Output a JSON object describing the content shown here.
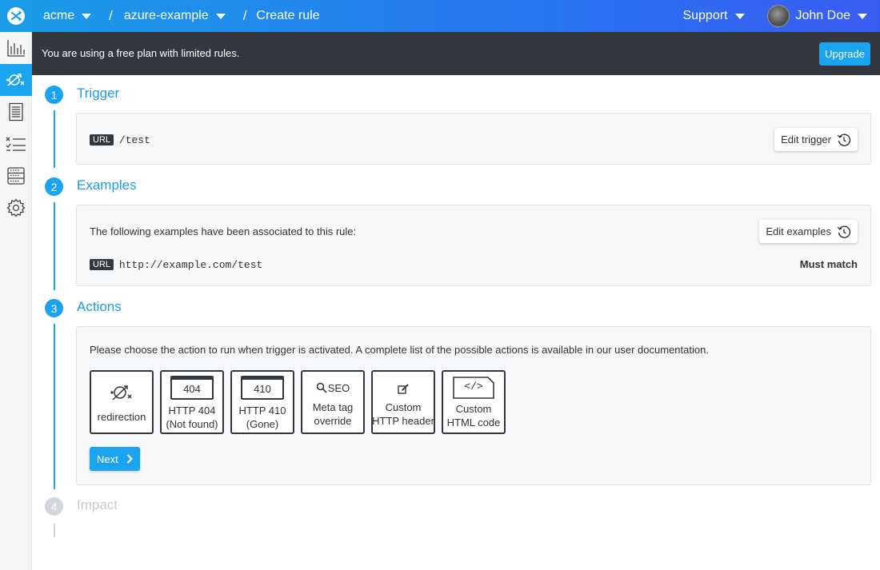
{
  "header": {
    "org": "acme",
    "project": "azure-example",
    "page": "Create rule",
    "support": "Support",
    "user": "John Doe"
  },
  "sidebar": {
    "items": [
      {
        "icon": "analytics-icon"
      },
      {
        "icon": "rules-icon",
        "active": true
      },
      {
        "icon": "logs-icon"
      },
      {
        "icon": "checklist-icon"
      },
      {
        "icon": "server-icon"
      },
      {
        "icon": "gear-icon"
      }
    ]
  },
  "banner": {
    "text": "You are using a free plan with limited rules.",
    "upgrade": "Upgrade"
  },
  "steps": [
    {
      "number": "1",
      "title": "Trigger"
    },
    {
      "number": "2",
      "title": "Examples"
    },
    {
      "number": "3",
      "title": "Actions"
    },
    {
      "number": "4",
      "title": "Impact"
    }
  ],
  "trigger": {
    "tag": "URL",
    "value": "/test",
    "edit_label": "Edit trigger"
  },
  "examples": {
    "intro": "The following examples have been associated to this rule:",
    "edit_label": "Edit examples",
    "items": [
      {
        "tag": "URL",
        "url": "http://example.com/test",
        "status": "Must match"
      }
    ]
  },
  "actions": {
    "intro": "Please choose the action to run when trigger is activated. A complete list of the possible actions is available in our user documentation.",
    "cards": [
      {
        "icon": "redirection-icon",
        "line1": "redirection",
        "line2": ""
      },
      {
        "icon": "page-404-icon",
        "code": "404",
        "line1": "HTTP 404",
        "line2": "(Not found)"
      },
      {
        "icon": "page-410-icon",
        "code": "410",
        "line1": "HTTP 410",
        "line2": "(Gone)"
      },
      {
        "icon": "seo-icon",
        "icon_text": "SEO",
        "line1": "Meta tag",
        "line2": "override"
      },
      {
        "icon": "edit-icon",
        "line1": "Custom",
        "line2": "HTTP header"
      },
      {
        "icon": "code-file-icon",
        "icon_text": "</>",
        "line1": "Custom",
        "line2": "HTML code"
      }
    ],
    "next_label": "Next"
  },
  "colors": {
    "accent": "#1aa3ef",
    "dark": "#33383e",
    "disabled": "#d3d7db"
  }
}
